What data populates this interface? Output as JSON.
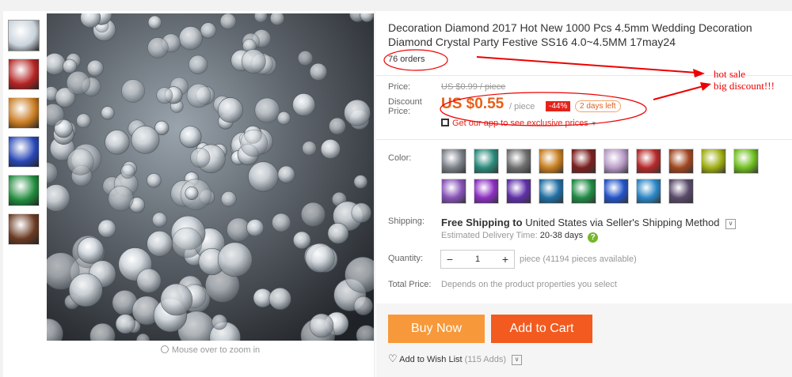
{
  "gallery": {
    "thumbs": [
      {
        "name": "clear",
        "color": "#c9d3db"
      },
      {
        "name": "red",
        "color": "#b42323"
      },
      {
        "name": "orange",
        "color": "#c87a20"
      },
      {
        "name": "blue",
        "color": "#2846b6"
      },
      {
        "name": "green",
        "color": "#1f8a3c"
      },
      {
        "name": "brown",
        "color": "#6a3a22"
      }
    ],
    "zoom_hint": "Mouse over to zoom in"
  },
  "product": {
    "title": "Decoration Diamond 2017 Hot New 1000 Pcs 4.5mm Wedding Decoration Diamond Crystal Party Festive SS16 4.0~4.5MM 17may24",
    "orders": "76 orders"
  },
  "price": {
    "label": "Price:",
    "old": "US $0.99 / piece",
    "discount_label_line1": "Discount",
    "discount_label_line2": "Price:",
    "new": "US $0.55",
    "unit": "/ piece",
    "discount_badge": "-44%",
    "days_left": "2 days left",
    "app_promo": "Get our app to see exclusive prices",
    "accent_color": "#e65f1a"
  },
  "color": {
    "label": "Color:",
    "swatches": [
      "#7b8088",
      "#2a8a7a",
      "#6f6f6f",
      "#c77e1f",
      "#7a1f1f",
      "#b89ac6",
      "#b52828",
      "#a1461f",
      "#9fae13",
      "#6fbf1f",
      "#8753b8",
      "#8b2fc1",
      "#5f2fa8",
      "#1f6fa3",
      "#1f8b44",
      "#2253c8",
      "#2a86c6",
      "#5a4a6a"
    ]
  },
  "shipping": {
    "label": "Shipping:",
    "text_prefix": "Free Shipping to",
    "text_bold": "United States via Seller's Shipping Method",
    "delivery_label": "Estimated Delivery Time:",
    "delivery_days": "20-38 days"
  },
  "quantity": {
    "label": "Quantity:",
    "value": "1",
    "available": "piece (41194 pieces available)"
  },
  "total": {
    "label": "Total Price:",
    "value": "Depends on the product properties you select"
  },
  "actions": {
    "buy_now": "Buy Now",
    "add_to_cart": "Add to Cart",
    "wishlist": "Add to Wish List",
    "wishlist_count": "(115 Adds)"
  },
  "annotations": {
    "hot_sale": "hot sale",
    "big_discount": "big discount!!!"
  }
}
